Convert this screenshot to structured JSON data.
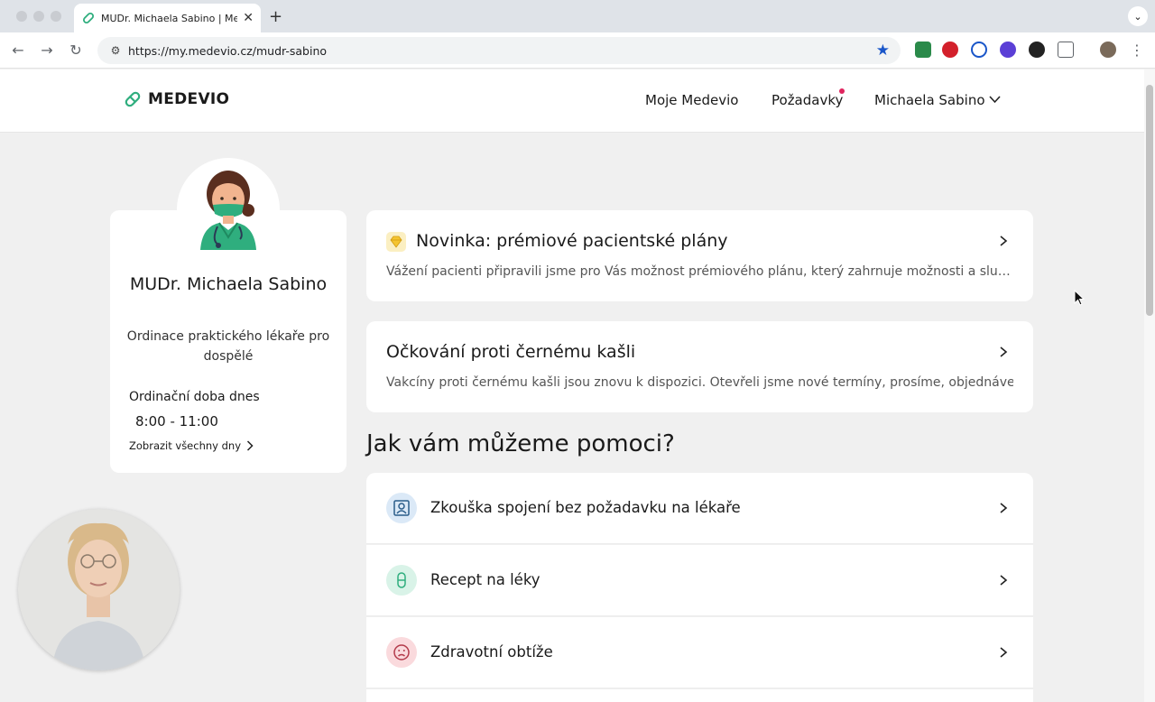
{
  "browser": {
    "tab_title": "MUDr. Michaela Sabino | Medevio",
    "tab_close": "✕",
    "new_tab": "+",
    "tab_menu": "⌄",
    "url": "https://my.medevio.cz/mudr-sabino",
    "back": "←",
    "forward": "→",
    "reload": "↻",
    "star": "★"
  },
  "header": {
    "logo": "MEDEVIO",
    "nav": [
      "Moje Medevio",
      "Požadavky",
      "Michaela Sabino"
    ],
    "notification_color": "#e0245e",
    "accent": "#2fae7e"
  },
  "doctor": {
    "name": "MUDr. Michaela Sabino",
    "specialty": "Ordinace praktického lékaře pro dospělé",
    "hours_title": "Ordinační doba dnes",
    "hours": "8:00 - 11:00",
    "all_days": "Zobrazit všechny dny"
  },
  "news": [
    {
      "title": "Novinka: prémiové pacientské plány",
      "body": "Vážení pacienti připravili jsme pro Vás možnost prémiového plánu, který zahrnuje možnosti a služby navíc.",
      "icon": "diamond-icon"
    },
    {
      "title": "Očkování proti černému kašli",
      "body": "Vakcíny proti černému kašli jsou znovu k dispozici. Otevřeli jsme nové termíny, prosíme, objednávejte"
    }
  ],
  "help": {
    "title": "Jak vám můžeme pomoci?",
    "services": [
      {
        "label": "Zkouška spojení bez požadavku na lékaře",
        "icon": "person-frame-icon",
        "bg": "#dbe9f7",
        "fg": "#2b5d8a"
      },
      {
        "label": "Recept na léky",
        "icon": "pill-icon",
        "bg": "#d9f3e8",
        "fg": "#2fae7e"
      },
      {
        "label": "Zdravotní obtíže",
        "icon": "sad-face-icon",
        "bg": "#fadadd",
        "fg": "#b33a4a"
      }
    ]
  }
}
